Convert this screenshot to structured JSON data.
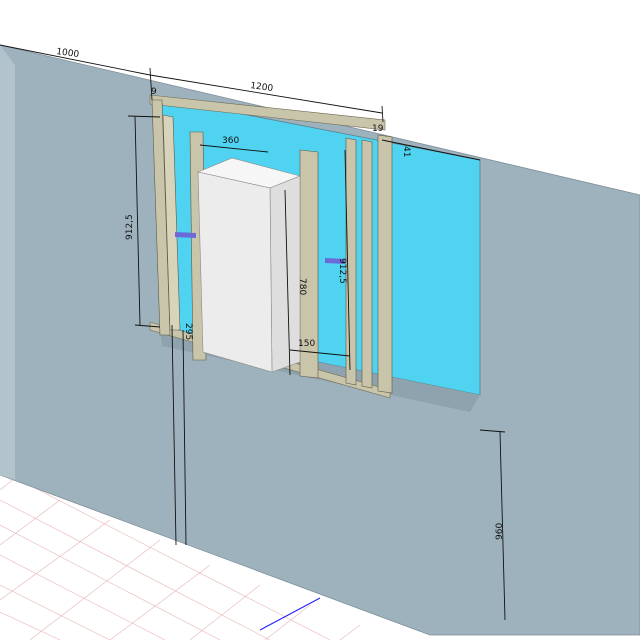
{
  "dimensions": {
    "wall_offset": "1000",
    "frame_width": "1200",
    "left_post": "9",
    "right_post": "19",
    "right_small": "41",
    "cistern_width": "360",
    "left_height": "912,5",
    "cistern_height": "780",
    "right_height": "912,5",
    "bottom_left": "295",
    "bottom_mid": "150",
    "sill_height": "960"
  },
  "colors": {
    "wall": "#9eb2bd",
    "wall_left": "#a8bbc5",
    "cavity": "#4fd3f0",
    "stud": "#c9c5aa",
    "cistern": "#ececec",
    "dim_line": "#111111",
    "grid": "#ff0000",
    "grid_axis": "#2020ff"
  }
}
